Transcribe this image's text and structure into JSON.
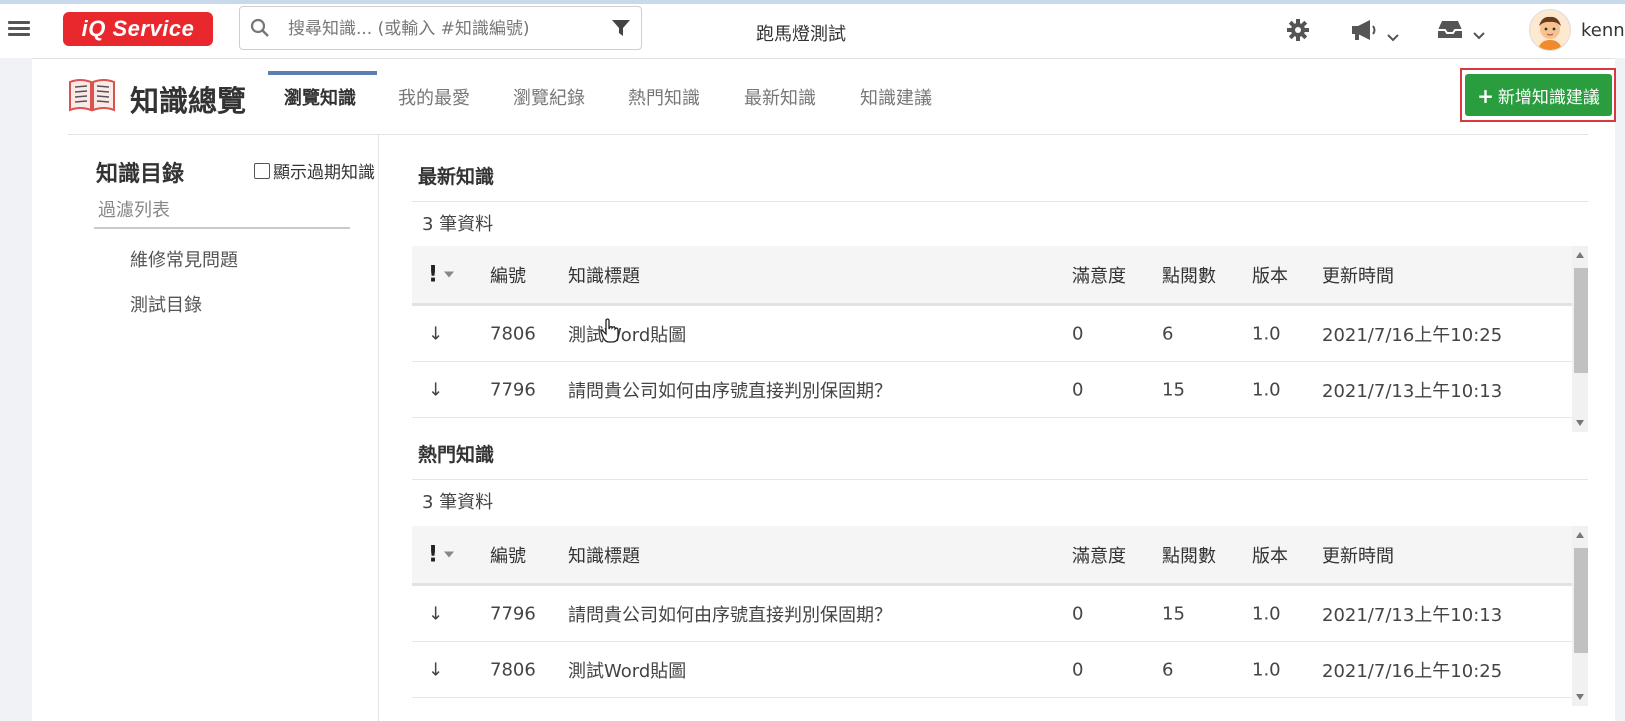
{
  "header": {
    "logo_text": "iQ Service",
    "search_placeholder": "搜尋知識... (或輸入 #知識編號)",
    "marquee_text": "跑馬燈測試",
    "username": "kenn"
  },
  "page": {
    "title": "知識總覽",
    "tabs": [
      {
        "label": "瀏覽知識",
        "active": true
      },
      {
        "label": "我的最愛"
      },
      {
        "label": "瀏覽紀錄"
      },
      {
        "label": "熱門知識"
      },
      {
        "label": "最新知識"
      },
      {
        "label": "知識建議"
      }
    ],
    "add_button_label": "新增知識建議"
  },
  "sidebar": {
    "title": "知識目錄",
    "show_expired_label": "顯示過期知識",
    "filter_placeholder": "過濾列表",
    "categories": [
      "維修常見問題",
      "測試目錄"
    ]
  },
  "table_headers": {
    "importance": "!",
    "id": "編號",
    "title": "知識標題",
    "satisfaction": "滿意度",
    "views": "點閱數",
    "version": "版本",
    "updated": "更新時間"
  },
  "sections": [
    {
      "title": "最新知識",
      "count": "3 筆資料",
      "rows": [
        {
          "priority": "↓",
          "id": "7806",
          "title": "測試Word貼圖",
          "satisfaction": "0",
          "views": "6",
          "version": "1.0",
          "updated": "2021/7/16上午10:25"
        },
        {
          "priority": "↓",
          "id": "7796",
          "title": "請問貴公司如何由序號直接判別保固期？",
          "satisfaction": "0",
          "views": "15",
          "version": "1.0",
          "updated": "2021/7/13上午10:13"
        }
      ]
    },
    {
      "title": "熱門知識",
      "count": "3 筆資料",
      "rows": [
        {
          "priority": "↓",
          "id": "7796",
          "title": "請問貴公司如何由序號直接判別保固期？",
          "satisfaction": "0",
          "views": "15",
          "version": "1.0",
          "updated": "2021/7/13上午10:13"
        },
        {
          "priority": "↓",
          "id": "7806",
          "title": "測試Word貼圖",
          "satisfaction": "0",
          "views": "6",
          "version": "1.0",
          "updated": "2021/7/16上午10:25"
        }
      ]
    }
  ],
  "colors": {
    "logo_red": "#e8282c",
    "add_button_green": "#2a9d3e",
    "highlight_frame": "#d9393c",
    "tab_underline": "#5b7fae"
  }
}
